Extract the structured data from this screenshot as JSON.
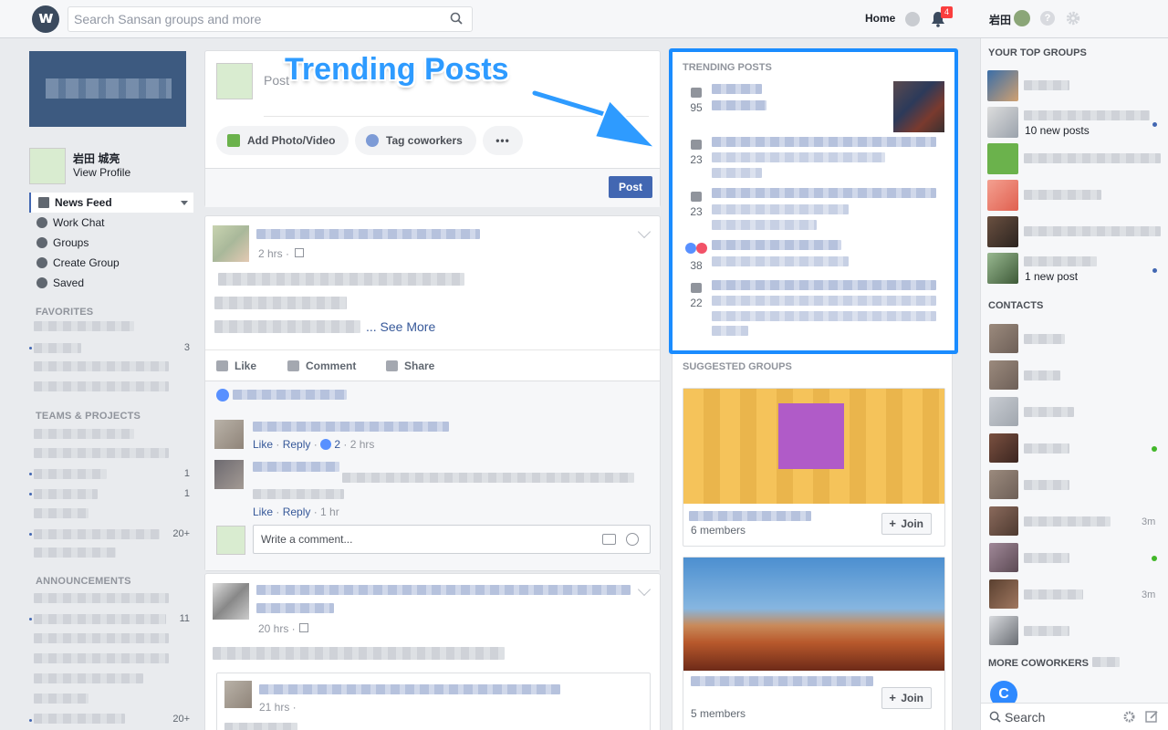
{
  "topbar": {
    "search_placeholder": "Search Sansan groups and more",
    "home_label": "Home",
    "notification_count": "4",
    "user_name": "岩田"
  },
  "left": {
    "profile_name": "岩田 城亮",
    "view_profile": "View Profile",
    "nav": [
      "News Feed",
      "Work Chat",
      "Groups",
      "Create Group",
      "Saved"
    ],
    "sections": {
      "favorites": "FAVORITES",
      "teams": "TEAMS & PROJECTS",
      "announcements": "ANNOUNCEMENTS"
    },
    "counts": {
      "fav1": "3",
      "team1": "1",
      "team2": "1",
      "team3": "20+",
      "ann1": "11",
      "ann2": "20+"
    }
  },
  "composer": {
    "prompt": "Post",
    "add_photo": "Add Photo/Video",
    "tag": "Tag coworkers",
    "more": "•••",
    "post_button": "Post"
  },
  "callout": {
    "text": "Trending Posts"
  },
  "post1": {
    "time": "2 hrs ·",
    "see_more": "... See More",
    "like": "Like",
    "comment": "Comment",
    "share": "Share",
    "c1_like": "Like",
    "c1_reply": "Reply",
    "c1_likes": "2",
    "c1_time": "· 2 hrs",
    "c2_like": "Like",
    "c2_reply": "Reply",
    "c2_time": "· 1 hr",
    "write_placeholder": "Write a comment..."
  },
  "post2": {
    "time": "20 hrs ·",
    "quote_time": "21 hrs ·"
  },
  "trending": {
    "header": "TRENDING POSTS",
    "counts": [
      "95",
      "23",
      "23",
      "38",
      "22"
    ]
  },
  "suggested": {
    "header": "SUGGESTED GROUPS",
    "groups": [
      {
        "members": "6 members",
        "join": "Join"
      },
      {
        "members": "5 members",
        "join": "Join"
      }
    ]
  },
  "farright": {
    "top_groups_header": "YOUR TOP GROUPS",
    "group_subs": [
      "10 new posts",
      "1 new post"
    ],
    "contacts_header": "CONTACTS",
    "contact_times": [
      "3m",
      "3m"
    ],
    "more_coworkers": "MORE COWORKERS",
    "coworker_initial": "C",
    "search_placeholder": "Search"
  },
  "colors": {
    "accent": "#4267b2",
    "callout": "#2e9bff",
    "trending_border": "#1a8cff",
    "badge": "#fa3e3e"
  },
  "icons": [
    "workplace-logo-icon",
    "search-icon",
    "chat-icon",
    "bell-icon",
    "help-icon",
    "gear-icon",
    "camera-icon",
    "smile-icon"
  ]
}
